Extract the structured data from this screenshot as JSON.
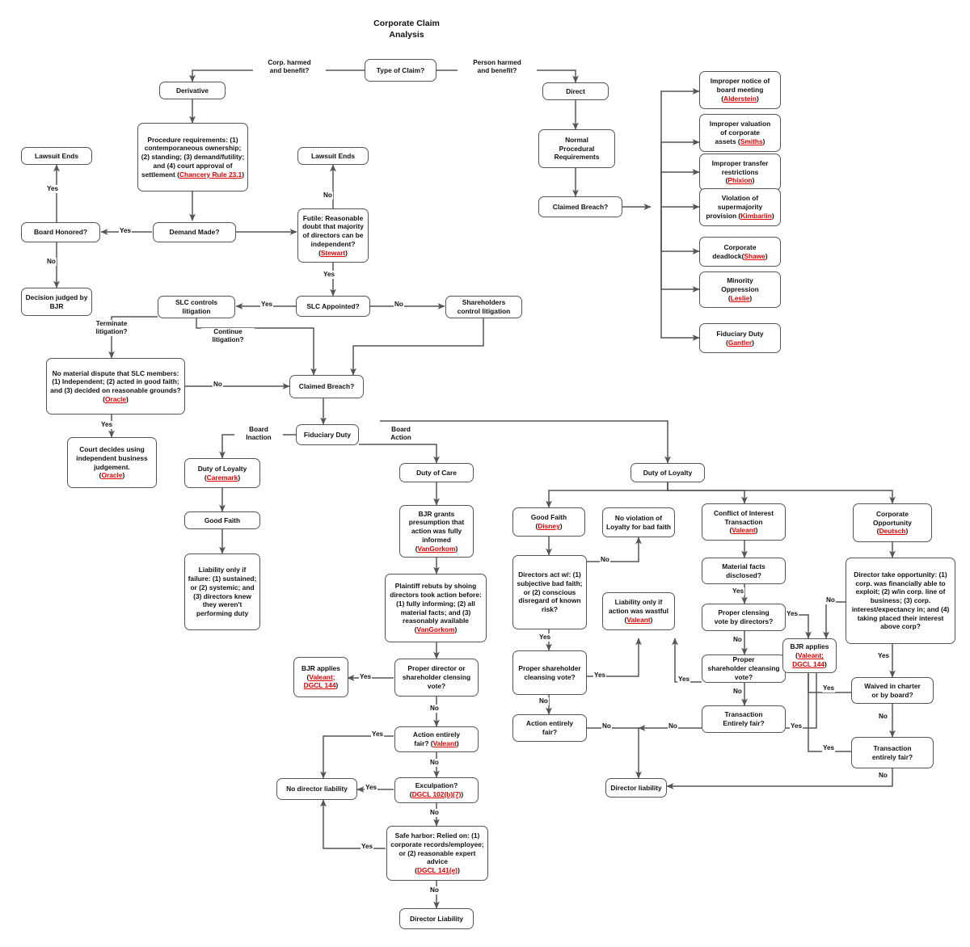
{
  "title": "Corporate Claim\nAnalysis",
  "title_lines": [
    "Corporate Claim",
    "Analysis"
  ],
  "colors": {
    "citation": "#e00000",
    "box_border": "#555555",
    "text": "#111111",
    "background": "#ffffff"
  },
  "nodes": {
    "type_of_claim": "Type of Claim?",
    "derivative": "Derivative",
    "direct": "Direct",
    "procedure_requirements": "Procedure requirements: (1) contemporaneous ownership; (2) standing; (3) demand/futility; and (4) court approval of settlement (Chancery Rule 23.1)",
    "procedure_requirements_cite": "Chancery Rule 23.1",
    "lawsuit_ends_left": "Lawsuit Ends",
    "lawsuit_ends_right": "Lawsuit Ends",
    "board_honored": "Board Honored?",
    "demand_made": "Demand Made?",
    "futile": "Futile: Reasonable doubt that majority of directors can be independent? (Stewart)",
    "futile_cite": "Stewart",
    "decision_judged_bjr": "Decision judged by BJR",
    "slc_controls": "SLC controls litigation",
    "slc_appointed": "SLC Appointed?",
    "shareholders_control": "Shareholders control litigation",
    "no_material_dispute": "No material dispute that SLC members: (1) Independent; (2) acted in good faith; and (3) decided on reasonable grounds? (Oracle)",
    "no_material_dispute_cite": "Oracle",
    "court_decides": "Court decides using independent business judgement. (Oracle)",
    "court_decides_cite": "Oracle",
    "claimed_breach_left": "Claimed Breach?",
    "claimed_breach_right": "Claimed Breach?",
    "fiduciary_duty_main": "Fiduciary Duty",
    "normal_procedural": "Normal Procedural Requirements",
    "improper_notice": "Improper notice of board meeting (Alderstein)",
    "improper_notice_cite": "Alderstein",
    "improper_valuation": "Improper valuation of corporate assets (Smiths)",
    "improper_valuation_cite": "Smiths",
    "improper_transfer": "Improper transfer restrictions (Phixion)",
    "improper_transfer_cite": "Phixion",
    "violation_supermajority": "Violation of supermajority provision (Kimbarlin)",
    "violation_supermajority_cite": "Kimbarlin",
    "corporate_deadlock": "Corporate deadlock(Shawe)",
    "corporate_deadlock_cite": "Shawe",
    "minority_oppression": "Minority Oppression (Leslie)",
    "minority_oppression_cite": "Leslie",
    "fiduciary_duty_right": "Fiduciary Duty (Gantler)",
    "fiduciary_duty_right_cite": "Gantler",
    "duty_loyalty_inaction": "Duty of Loyalty (Caremark)",
    "duty_loyalty_inaction_cite": "Caremark",
    "good_faith_left": "Good Faith",
    "liability_only_failure": "Liability only if failure: (1) sustained; or (2) systemic; and (3) directors knew they weren't performing duty",
    "duty_of_care": "Duty of Care",
    "bjr_grants": "BJR grants presumption that action was fully informed (VanGorkom)",
    "bjr_grants_cite": "VanGorkom",
    "plaintiff_rebuts": "Plaintiff rebuts by shoing directors took action before: (1) fully informing; (2) all material facts; and (3) reasonably available (VanGorkom)",
    "plaintiff_rebuts_cite": "VanGorkom",
    "proper_director_vote": "Proper director or shareholder clensing vote?",
    "bjr_applies_care": "BJR applies (Valeant; DGCL 144)",
    "bjr_applies_care_cite1": "Valeant;",
    "bjr_applies_care_cite2": "DGCL 144",
    "action_entirely_fair_care": "Action entirely fair? (Valeant)",
    "action_entirely_fair_care_cite": "Valeant",
    "no_director_liability": "No director liability",
    "exculpation": "Exculpation? (DGCL 102(b)(7))",
    "exculpation_cite": "DGCL 102(b)(7)",
    "safe_harbor": "Safe harbor: Relied on: (1) corporate records/employee; or (2) reasonable expert advice (DGCL 141(e))",
    "safe_harbor_cite": "DGCL 141(e)",
    "director_liability_bottom": "Director Liability",
    "duty_loyalty_action": "Duty of Loyalty",
    "good_faith_disney": "Good Faith (Disney)",
    "good_faith_disney_cite": "Disney",
    "directors_act_bad_faith": "Directors act w/: (1) subjective bad faith; or (2) conscious disregard of known risk?",
    "no_violation_loyalty": "No violation of Loyalty for bad faith",
    "proper_shareholder_vote_gf": "Proper shareholder cleansing vote?",
    "liability_wasteful": "Liability only if action was wastful (Valeant)",
    "liability_wasteful_cite": "Valeant",
    "action_entirely_fair_gf": "Action entirely fair?",
    "conflict_of_interest": "Conflict of Interest Transaction (Valeant)",
    "conflict_of_interest_cite": "Valeant",
    "material_facts_disclosed": "Material facts disclosed?",
    "proper_cleansing_directors": "Proper clensing vote by directors?",
    "proper_shareholder_vote_coi": "Proper shareholder cleansing vote?",
    "transaction_entirely_fair_coi": "Transaction Entirely fair?",
    "bjr_applies_right": "BJR applies (Valeant; DGCL 144)",
    "bjr_applies_right_cite1": "Valeant;",
    "bjr_applies_right_cite2": "DGCL 144",
    "corporate_opportunity": "Corporate Opportunity (Deutsch)",
    "corporate_opportunity_cite": "Deutsch",
    "director_take_opportunity": "Director take opportunity: (1) corp. was financially able to exploit; (2) w/in corp. line of business; (3) corp. interest/expectancy in; and (4) taking placed their interest above corp?",
    "waived_in_charter": "Waived in charter or by board?",
    "transaction_entirely_fair_co": "Transaction entirely fair?",
    "director_liability_right": "Director liability"
  },
  "edge_labels": {
    "corp_harmed": "Corp. harmed and benefit?",
    "person_harmed": "Person harmed and benefit?",
    "yes_board_honored": "Yes",
    "yes_lawsuit_ends_left": "Yes",
    "no_decision_bjr": "No",
    "no_lawsuit_ends_right": "No",
    "yes_slc_appointed": "Yes",
    "yes_slc_controls": "Yes",
    "no_shareholders": "No",
    "terminate_litigation": "Terminate litigation?",
    "continue_litigation": "Continue litigation?",
    "no_claimed_breach": "No",
    "yes_court_decides": "Yes",
    "board_inaction": "Board Inaction",
    "board_action": "Board Action",
    "yes_bjr_applies_care": "Yes",
    "no_action_fair_care": "No",
    "yes_no_liability_fair": "Yes",
    "no_exculpation": "No",
    "yes_no_liability_exculp": "Yes",
    "no_safe_harbor": "No",
    "yes_no_liability_safe": "Yes",
    "no_director_liability_bottom": "No",
    "no_bad_faith": "No",
    "yes_proper_shareholder_gf": "Yes",
    "no_action_fair_gf": "No",
    "yes_liability_wasteful_gf": "Yes",
    "no_action_entirely_fair_gf": "No",
    "no_director_liability_mid": "No",
    "yes_material_facts": "Yes",
    "no_proper_cleansing": "No",
    "yes_proper_cleansing": "Yes",
    "no_proper_shareholder_coi": "No",
    "yes_transaction_fair_coi": "Yes",
    "yes_liability_wasteful_coi": "Yes",
    "no_director_take": "No",
    "yes_director_take": "Yes",
    "yes_waived": "Yes",
    "no_waived": "No",
    "yes_transaction_fair_co": "Yes",
    "no_transaction_fair_co": "No"
  }
}
